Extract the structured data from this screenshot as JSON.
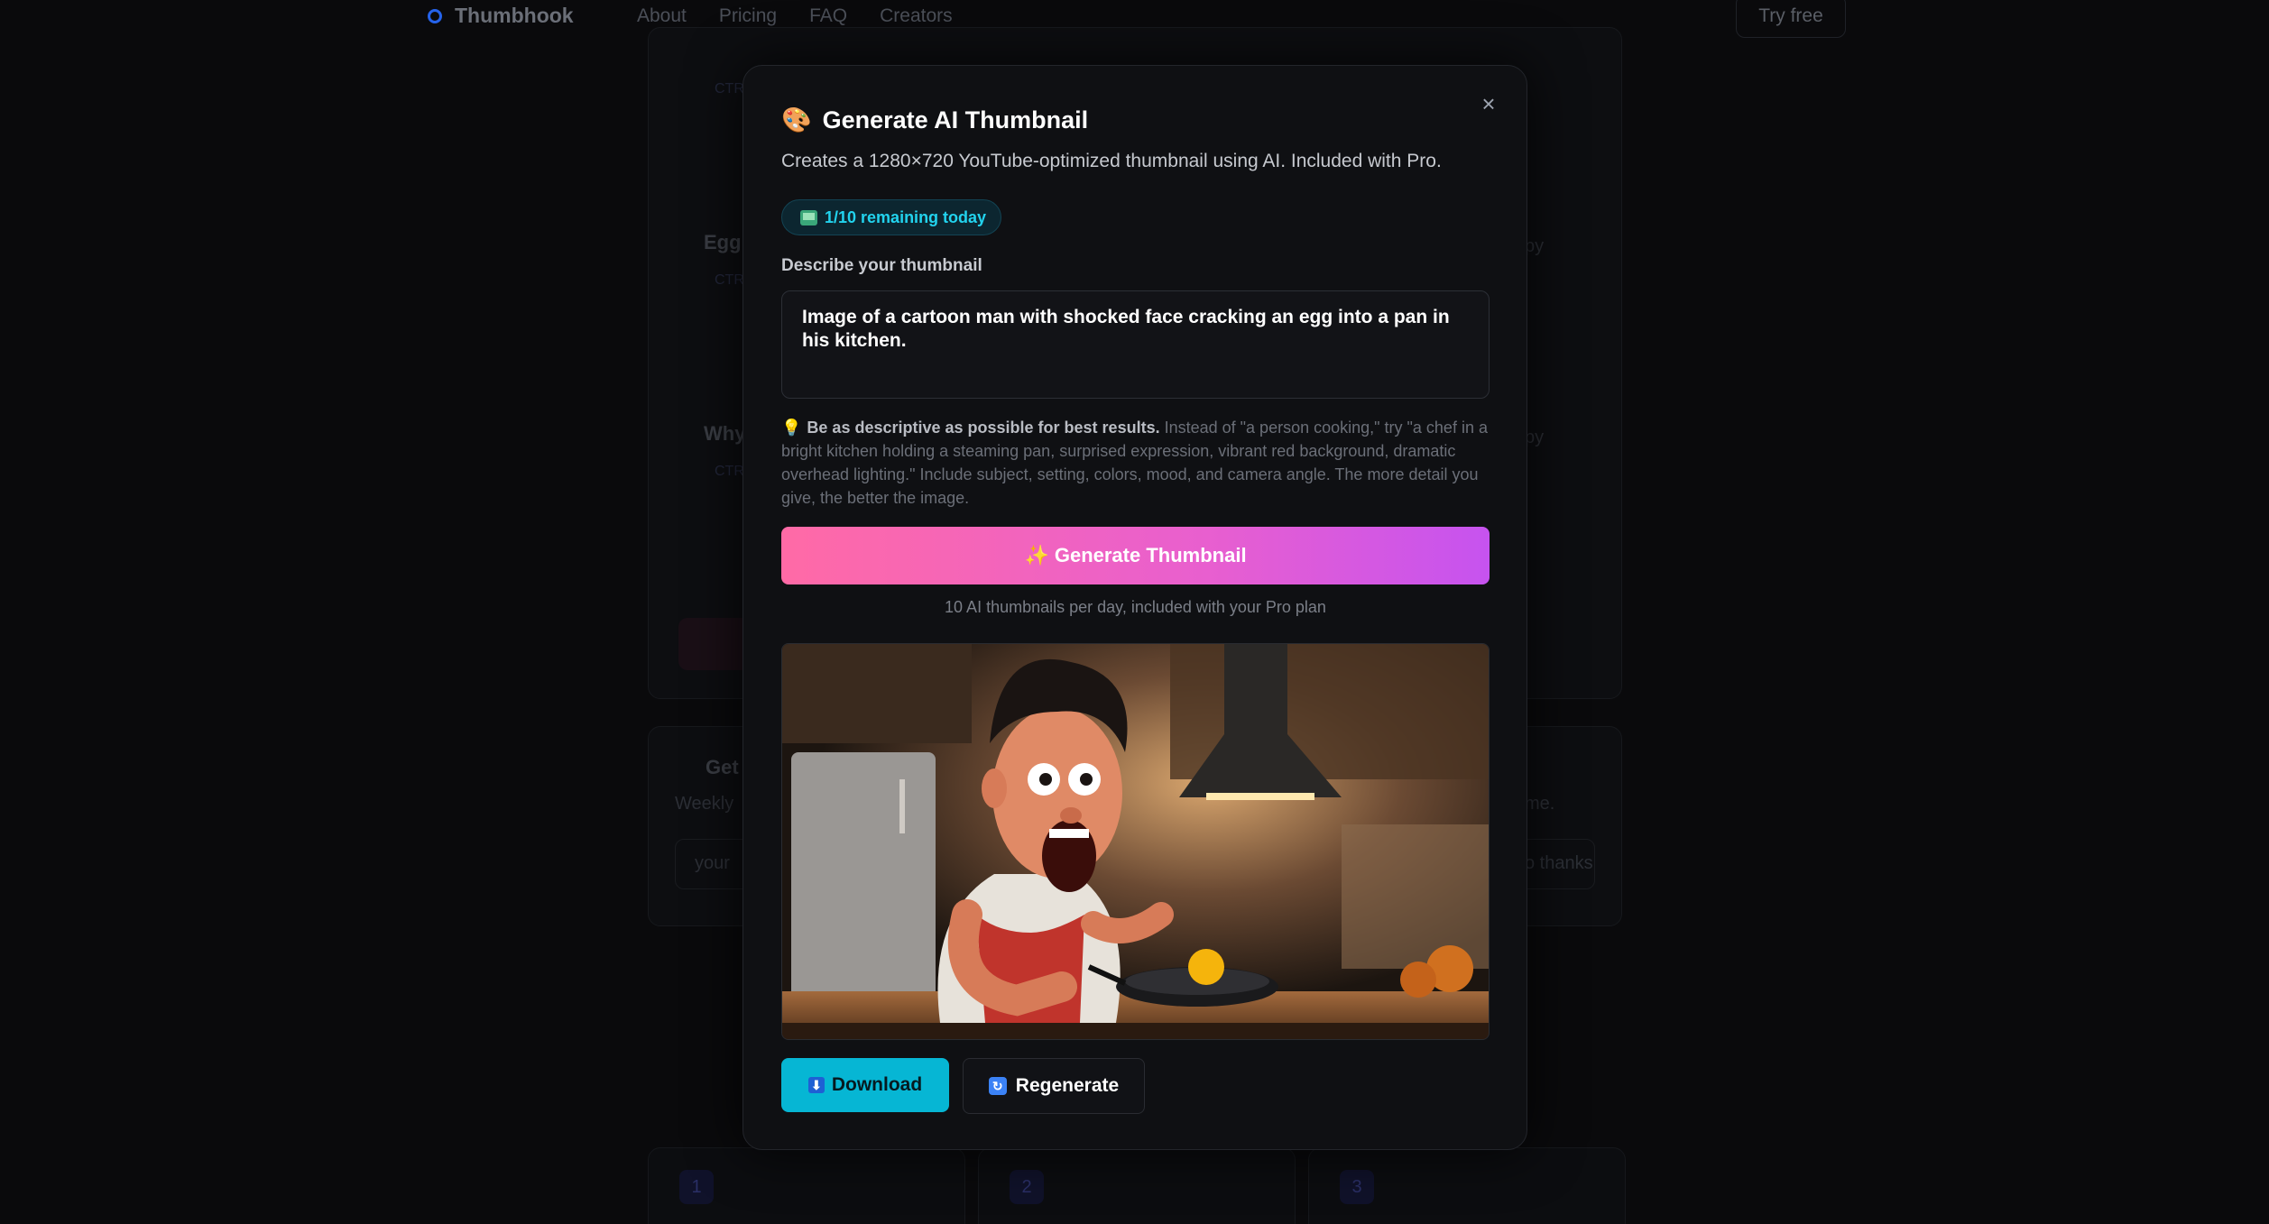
{
  "nav": {
    "brand": "Thumbhook",
    "links": [
      "About",
      "Pricing",
      "FAQ",
      "Creators"
    ],
    "cta": "Try free"
  },
  "background": {
    "section_titles": [
      "Egg",
      "Why"
    ],
    "tag": "CTR",
    "newsletter_title": "Get",
    "newsletter_sub": "Weekly",
    "newsletter_placeholder": "your",
    "newsletter_tail": "me.",
    "no_thanks": "o thanks",
    "copy_label": "py",
    "step_numbers": [
      "1",
      "2",
      "3"
    ]
  },
  "modal": {
    "title_icon": "🎨",
    "title": "Generate AI Thumbnail",
    "subtitle": "Creates a 1280×720 YouTube-optimized thumbnail using AI. Included with Pro.",
    "quota": "1/10 remaining today",
    "field_label": "Describe your thumbnail",
    "prompt_value": "Image of a cartoon man with shocked face cracking an egg into a pan in his kitchen.",
    "tip_bold": "Be as descriptive as possible for best results.",
    "tip_rest": " Instead of \"a person cooking,\" try \"a chef in a bright kitchen holding a steaming pan, surprised expression, vibrant red background, dramatic overhead lighting.\" Include subject, setting, colors, mood, and camera angle. The more detail you give, the better the image.",
    "generate_label": "Generate Thumbnail",
    "generate_icon": "✨",
    "generate_note": "10 AI thumbnails per day, included with your Pro plan",
    "download_label": "Download",
    "regenerate_label": "Regenerate",
    "close_glyph": "×"
  },
  "colors": {
    "accent_cyan": "#06b6d4",
    "gradient_start": "#ff6aa6",
    "gradient_end": "#c653ef",
    "modal_bg": "#0f1013"
  }
}
